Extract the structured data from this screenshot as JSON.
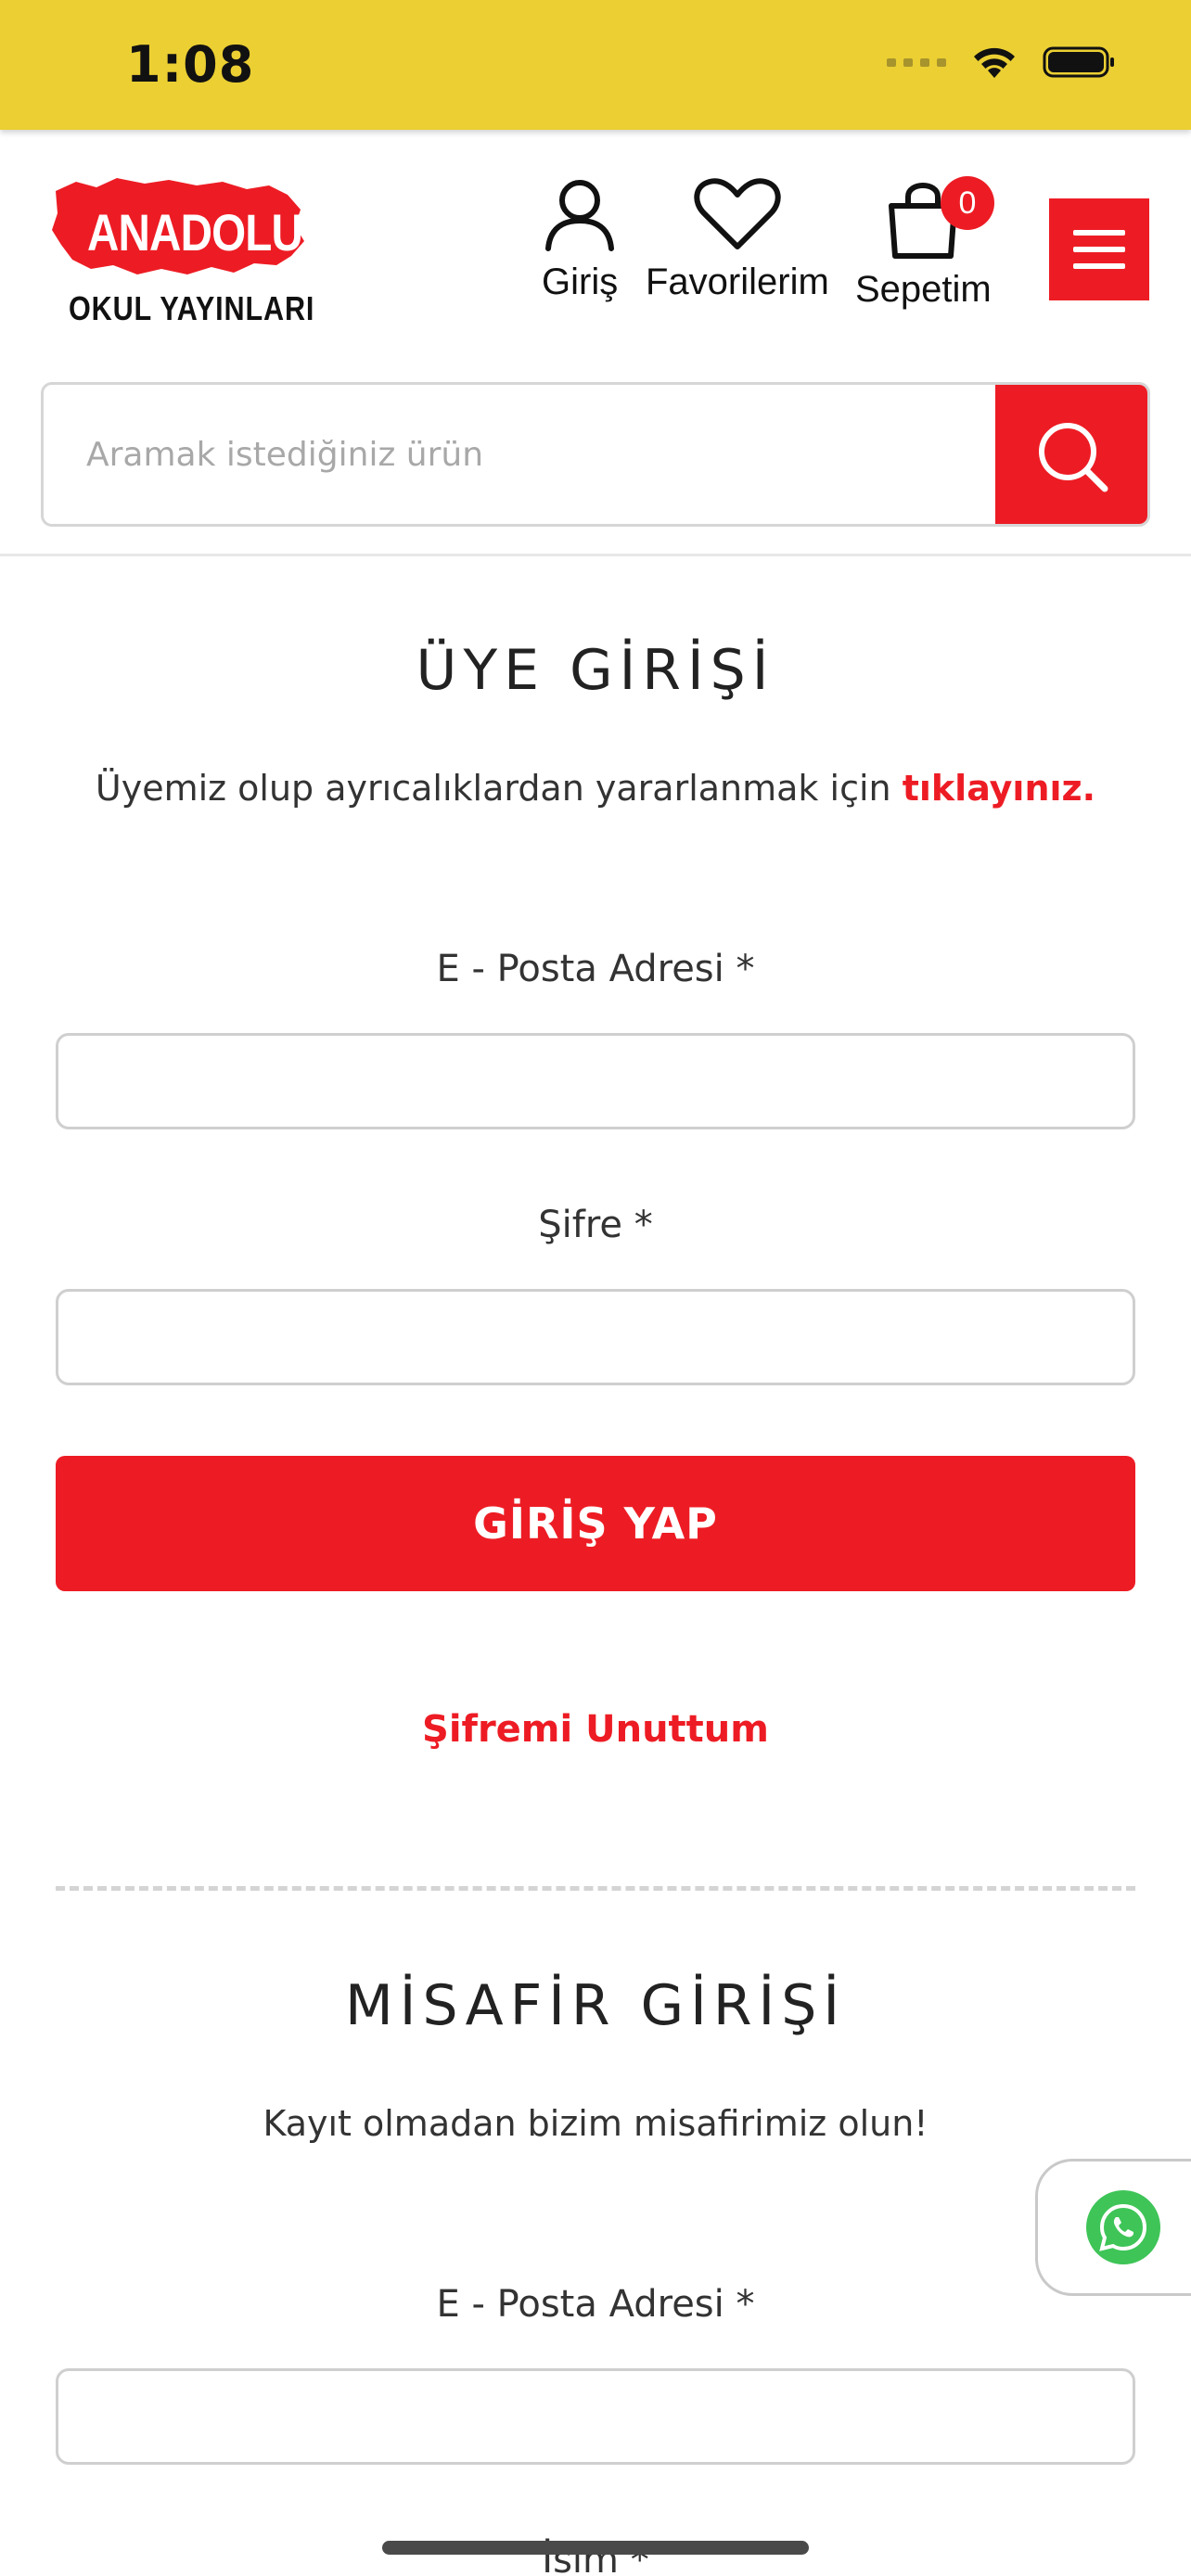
{
  "status_bar": {
    "time": "1:08"
  },
  "header": {
    "logo_brand": "ANADOLU",
    "logo_sub": "OKUL YAYINLARI",
    "login_label": "Giriş",
    "favorites_label": "Favorilerim",
    "cart_label": "Sepetim",
    "cart_count": "0",
    "search_placeholder": "Aramak istediğiniz ürün"
  },
  "member_login": {
    "title": "ÜYE GİRİŞİ",
    "lead_text": "Üyemiz olup ayrıcalıklardan yararlanmak için",
    "lead_link": "tıklayınız.",
    "email_label": "E - Posta Adresi *",
    "password_label": "Şifre *",
    "submit_label": "GİRİŞ YAP",
    "forgot_label": "Şifremi Unuttum"
  },
  "guest_login": {
    "title": "MİSAFİR GİRİŞİ",
    "lead_text": "Kayıt olmadan bizim misafirimiz olun!",
    "email_label": "E - Posta Adresi *",
    "name_label": "İsim *"
  },
  "colors": {
    "status_bar": "#EBCF33",
    "accent_red": "#ED1C24",
    "whatsapp_green": "#3EC457"
  },
  "icons": {
    "user": "user-icon",
    "heart": "heart-icon",
    "bag": "shopping-bag-icon",
    "menu": "hamburger-menu-icon",
    "search": "search-icon",
    "whatsapp": "whatsapp-icon"
  }
}
